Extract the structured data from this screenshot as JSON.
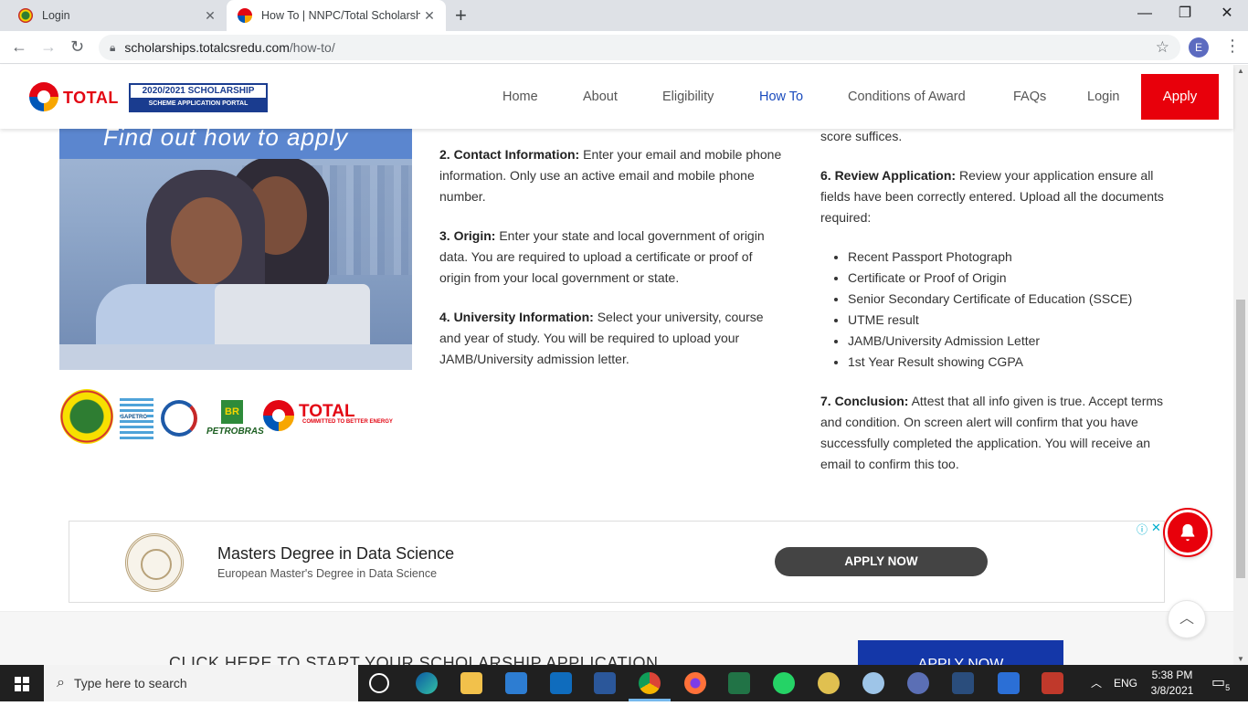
{
  "browser": {
    "tabs": [
      {
        "title": "Login",
        "active": false
      },
      {
        "title": "How To | NNPC/Total Scholarship",
        "active": true
      }
    ],
    "url_host": "scholarships.totalcsredu.com",
    "url_path": "/how-to/",
    "profile_initial": "E"
  },
  "site": {
    "logo_text": "TOTAL",
    "badge_top": "2020/2021 SCHOLARSHIP",
    "badge_bottom": "SCHEME APPLICATION PORTAL",
    "nav": [
      "Home",
      "About",
      "Eligibility",
      "How To",
      "Conditions of Award",
      "FAQs",
      "Login"
    ],
    "nav_current": "How To",
    "apply_label": "Apply",
    "accent_color": "#e8000b",
    "link_color": "#1a4bbd"
  },
  "hero": {
    "banner": "Find out how to apply"
  },
  "partners": {
    "sapetro": "SAPETRO",
    "br": "BR",
    "petrobras": "PETROBRAS",
    "total": "TOTAL",
    "total_tagline": "COMMITTED TO BETTER ENERGY"
  },
  "steps_middle": [
    {
      "heading": "2. Contact Information:",
      "text": " Enter your email and mobile phone information. Only use an active email and mobile phone number."
    },
    {
      "heading": "3. Origin:",
      "text": " Enter your state and local government of origin data. You are required to upload a certificate or proof of origin from your local government or state."
    },
    {
      "heading": "4. University Information:",
      "text": " Select your university, course and year of study. You will be required to upload your JAMB/University admission letter."
    }
  ],
  "steps_right": {
    "overflow_text": "score suffices.",
    "review_heading": "6. Review Application:",
    "review_text": " Review your application ensure all fields have been correctly entered. Upload all the documents required:",
    "documents": [
      "Recent Passport Photograph",
      "Certificate or Proof of Origin",
      "Senior Secondary Certificate of Education (SSCE)",
      "UTME result",
      "JAMB/University Admission Letter",
      "1st Year Result showing CGPA"
    ],
    "conclusion_heading": "7. Conclusion:",
    "conclusion_text": " Attest that all info given is true. Accept terms and condition. On screen alert will confirm that you have successfully completed the application. You will receive an email to confirm this too."
  },
  "ad": {
    "title": "Masters Degree in Data Science",
    "subtitle": "European Master's Degree in Data Science",
    "button": "APPLY NOW",
    "info_icon": "ⓘ",
    "close_icon": "✕"
  },
  "cta": {
    "text": "CLICK HERE TO START YOUR SCHOLARSHIP APPLICATION",
    "button": "APPLY NOW"
  },
  "taskbar": {
    "search_placeholder": "Type here to search",
    "language": "ENG",
    "time": "5:38 PM",
    "date": "3/8/2021",
    "notifications": "5"
  }
}
